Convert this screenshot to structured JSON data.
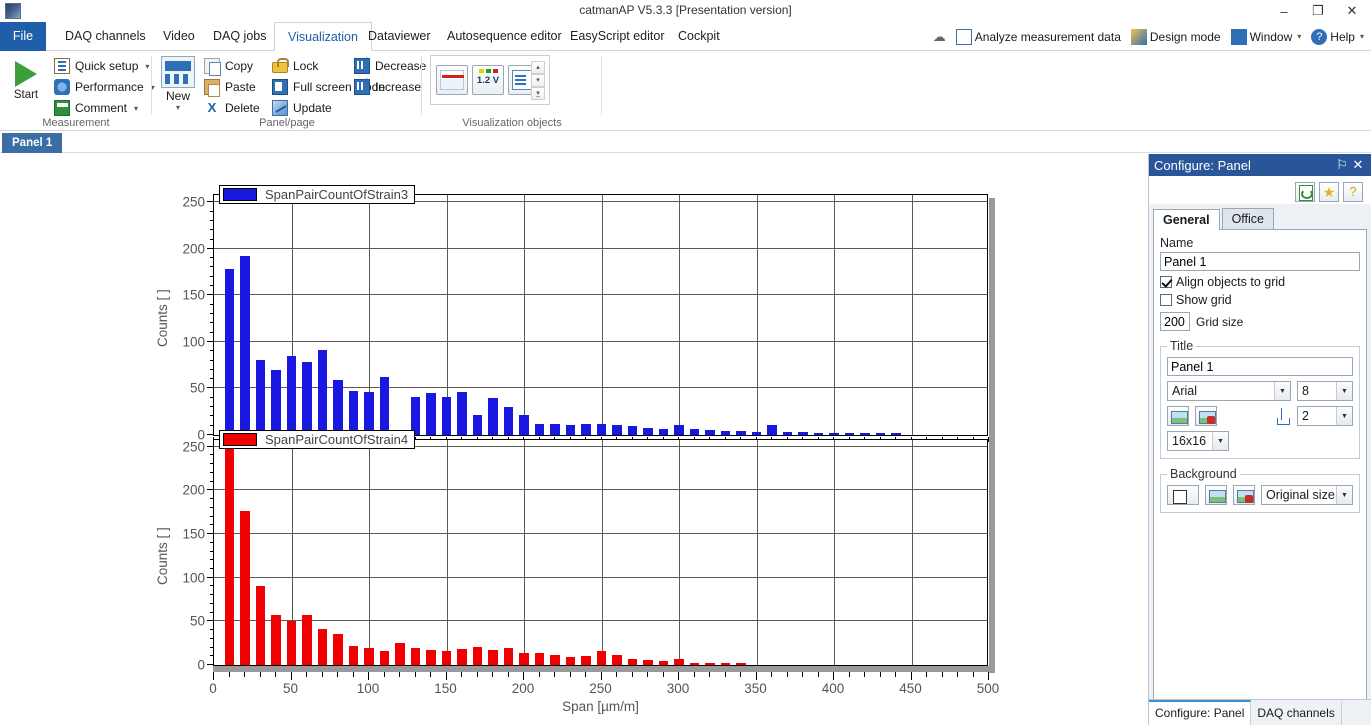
{
  "window": {
    "title": "catmanAP V5.3.3 [Presentation version]",
    "minimize": "–",
    "maximize": "❐",
    "close": "✕",
    "app_icon": "app-logo-icon"
  },
  "ribbon_tabs": [
    {
      "label": "File",
      "active": false,
      "file": true
    },
    {
      "label": "DAQ channels",
      "active": false
    },
    {
      "label": "Video",
      "active": false
    },
    {
      "label": "DAQ jobs",
      "active": false
    },
    {
      "label": "Visualization",
      "active": true
    },
    {
      "label": "Dataviewer",
      "active": false
    },
    {
      "label": "Autosequence editor",
      "active": false
    },
    {
      "label": "EasyScript editor",
      "active": false
    },
    {
      "label": "Cockpit",
      "active": false
    }
  ],
  "ribbon_right": [
    {
      "label": "",
      "icon": "cloud-icon"
    },
    {
      "label": "Analyze measurement data",
      "icon": "analyze-icon"
    },
    {
      "label": "Design mode",
      "icon": "design-mode-icon"
    },
    {
      "label": "Window",
      "icon": "window-icon",
      "caret": "▾"
    },
    {
      "label": "Help",
      "icon": "help-icon",
      "caret": "▾"
    }
  ],
  "ribbon_groups": {
    "measurement": {
      "label": "Measurement",
      "start": "Start",
      "items": [
        {
          "label": "Quick setup",
          "icon": "quick-setup-icon",
          "caret": "▾"
        },
        {
          "label": "Performance",
          "icon": "performance-icon",
          "caret": "▾"
        },
        {
          "label": "Comment",
          "icon": "comment-icon",
          "caret": "▾"
        }
      ]
    },
    "panel_page": {
      "label": "Panel/page",
      "new": "New",
      "new_caret": "▾",
      "col1": [
        {
          "label": "Copy",
          "icon": "copy-icon"
        },
        {
          "label": "Paste",
          "icon": "paste-icon"
        },
        {
          "label": "Delete",
          "icon": "delete-x-icon"
        }
      ],
      "col2": [
        {
          "label": "Lock",
          "icon": "lock-icon"
        },
        {
          "label": "Full screen mode",
          "icon": "full-screen-icon"
        },
        {
          "label": "Update",
          "icon": "update-icon"
        }
      ],
      "col3": [
        {
          "label": "Decrease",
          "icon": "decrease-icon"
        },
        {
          "label": "Increase",
          "icon": "increase-icon"
        }
      ]
    },
    "visualization_objects": {
      "label": "Visualization objects",
      "items": [
        {
          "name": "graph-object",
          "label": ""
        },
        {
          "name": "digital-display-object",
          "label": "1.2 V"
        },
        {
          "name": "table-object",
          "label": ""
        }
      ],
      "spinners": [
        "▴",
        "▾",
        "▾̲"
      ]
    }
  },
  "panel_tab": {
    "label": "Panel 1"
  },
  "configure_panel": {
    "title": "Configure: Panel",
    "pin_icon": "⚐",
    "close_icon": "✕",
    "toolbar": [
      {
        "name": "refresh-button",
        "label": ""
      },
      {
        "name": "favorite-button",
        "label": "★"
      },
      {
        "name": "help-balloon-button",
        "label": "?"
      }
    ],
    "tabs": [
      {
        "label": "General",
        "active": true
      },
      {
        "label": "Office",
        "active": false
      }
    ],
    "name_label": "Name",
    "name_value": "Panel 1",
    "align_objects_label": "Align objects to grid",
    "align_objects_checked": true,
    "show_grid_label": "Show grid",
    "show_grid_checked": false,
    "grid_size_value": "200",
    "grid_size_label": "Grid size",
    "title_group_label": "Title",
    "title_value": "Panel 1",
    "font_family": "Arial",
    "font_size": "8",
    "icon_size": "16x16",
    "indent_value": "2",
    "background_group_label": "Background",
    "background_fit": "Original size",
    "bottom_tabs": [
      {
        "label": "Configure: Panel",
        "active": true
      },
      {
        "label": "DAQ channels",
        "active": false
      }
    ]
  },
  "chart_data": [
    {
      "type": "bar",
      "name": "top-chart",
      "title": "",
      "legend": "SpanPairCountOfStrain3",
      "legend_position": "top-left-inside",
      "color": "#1818e0",
      "xlabel": "",
      "ylabel": "Counts [ ]",
      "xlim": [
        0,
        500
      ],
      "ylim": [
        0,
        260
      ],
      "yticks": [
        0,
        50,
        100,
        150,
        200,
        250
      ],
      "xticks": [
        0,
        50,
        100,
        150,
        200,
        250,
        300,
        350,
        400,
        450,
        500
      ],
      "grid": true,
      "bin_width": 10,
      "x": [
        10,
        20,
        30,
        40,
        50,
        60,
        70,
        80,
        90,
        100,
        110,
        120,
        130,
        140,
        150,
        160,
        170,
        180,
        190,
        200,
        210,
        220,
        230,
        240,
        250,
        260,
        270,
        280,
        290,
        300,
        310,
        320,
        330,
        340,
        350,
        360,
        370,
        380,
        390,
        400,
        410,
        420,
        430,
        440,
        450,
        460,
        470,
        480,
        490
      ],
      "values": [
        178,
        192,
        81,
        70,
        85,
        78,
        91,
        59,
        47,
        46,
        62,
        0,
        41,
        45,
        41,
        46,
        21,
        40,
        30,
        21,
        12,
        12,
        11,
        12,
        12,
        11,
        10,
        8,
        7,
        11,
        6,
        5,
        4,
        4,
        3,
        11,
        3,
        3,
        2,
        1,
        1,
        1,
        1,
        1,
        0,
        0,
        0,
        0,
        0
      ]
    },
    {
      "type": "bar",
      "name": "bottom-chart",
      "title": "",
      "legend": "SpanPairCountOfStrain4",
      "legend_position": "top-left-inside",
      "color": "#f00000",
      "xlabel": "Span [µm/m]",
      "ylabel": "Counts [ ]",
      "xlim": [
        0,
        500
      ],
      "ylim": [
        0,
        260
      ],
      "yticks": [
        0,
        50,
        100,
        150,
        200,
        250
      ],
      "xticks": [
        0,
        50,
        100,
        150,
        200,
        250,
        300,
        350,
        400,
        450,
        500
      ],
      "grid": true,
      "bin_width": 10,
      "x": [
        10,
        20,
        30,
        40,
        50,
        60,
        70,
        80,
        90,
        100,
        110,
        120,
        130,
        140,
        150,
        160,
        170,
        180,
        190,
        200,
        210,
        220,
        230,
        240,
        250,
        260,
        270,
        280,
        290,
        300,
        310,
        320,
        330,
        340,
        350,
        360,
        370,
        380,
        390,
        400,
        410,
        420,
        430,
        440,
        450,
        460,
        470,
        480,
        490
      ],
      "values": [
        258,
        176,
        91,
        57,
        50,
        57,
        41,
        36,
        22,
        19,
        16,
        25,
        19,
        17,
        16,
        18,
        21,
        17,
        20,
        14,
        14,
        12,
        9,
        10,
        16,
        11,
        7,
        6,
        5,
        7,
        2,
        2,
        1,
        1,
        0,
        0,
        0,
        0,
        0,
        0,
        0,
        0,
        0,
        0,
        0,
        0,
        0,
        0,
        0
      ]
    }
  ]
}
